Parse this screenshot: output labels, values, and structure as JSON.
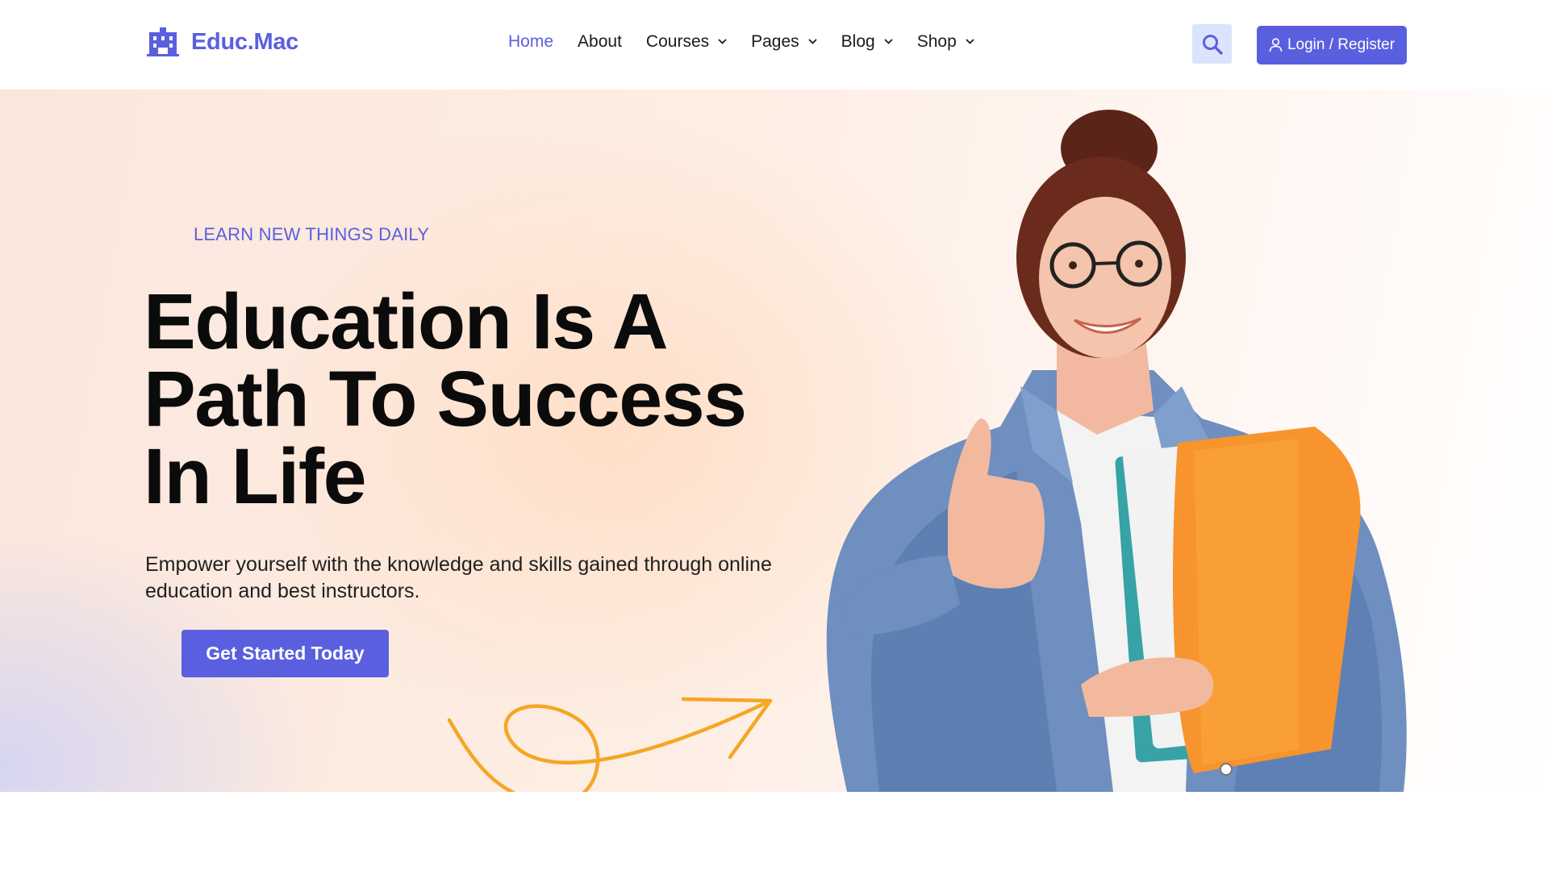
{
  "brand": {
    "name": "Educ.Mac",
    "logo_icon": "building-icon",
    "accent_color": "#5a5fdf"
  },
  "nav": {
    "items": [
      {
        "label": "Home",
        "active": true,
        "has_dropdown": false
      },
      {
        "label": "About",
        "active": false,
        "has_dropdown": false
      },
      {
        "label": "Courses",
        "active": false,
        "has_dropdown": true
      },
      {
        "label": "Pages",
        "active": false,
        "has_dropdown": true
      },
      {
        "label": "Blog",
        "active": false,
        "has_dropdown": true
      },
      {
        "label": "Shop",
        "active": false,
        "has_dropdown": true
      }
    ],
    "dropdown_icon": "chevron-down-icon"
  },
  "header_actions": {
    "search_icon": "search-icon",
    "search_bg_color": "#dbe4fd",
    "login_icon": "user-icon",
    "login_label": "Login / Register"
  },
  "hero": {
    "eyebrow": "LEARN NEW THINGS DAILY",
    "headline_lines": [
      "Education Is A",
      "Path To Success",
      "In Life"
    ],
    "subtext": "Empower yourself with the knowledge and skills gained through online education and best instructors.",
    "cta_label": "Get Started Today",
    "arrow_color": "#f5a623",
    "image": "smiling student with glasses in denim jacket giving thumbs up while holding orange folders"
  }
}
